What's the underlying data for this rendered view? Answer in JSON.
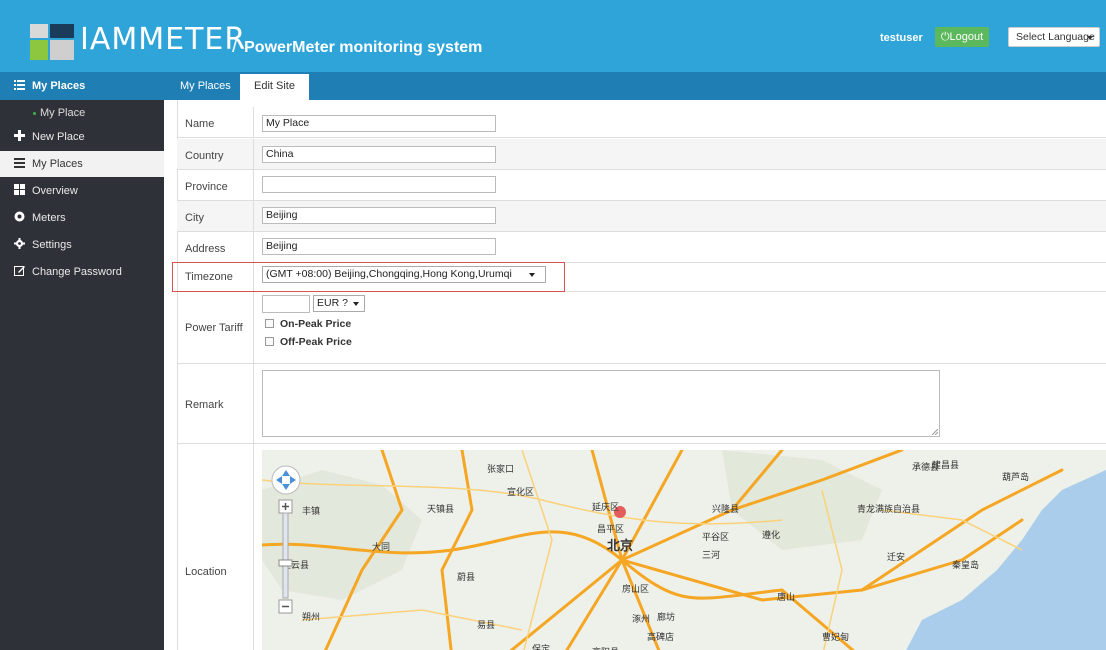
{
  "header": {
    "brand": "IAMMETER",
    "subtitle": "PowerMeter monitoring system",
    "username": "testuser",
    "logout_label": "Logout",
    "language_label": "Select Language",
    "bg_color": "#2fa4d8"
  },
  "sidebar": {
    "head": "My Places",
    "items": [
      {
        "label": "My Place",
        "icon": "dot-icon"
      },
      {
        "label": "New Place",
        "icon": "plus-icon"
      },
      {
        "label": "My Places",
        "icon": "list-icon"
      },
      {
        "label": "Overview",
        "icon": "grid-icon"
      },
      {
        "label": "Meters",
        "icon": "meter-icon"
      },
      {
        "label": "Settings",
        "icon": "gear-icon"
      },
      {
        "label": "Change Password",
        "icon": "edit-icon"
      }
    ]
  },
  "tabs": [
    {
      "label": "My Places"
    },
    {
      "label": "Edit Site"
    }
  ],
  "form": {
    "name_label": "Name",
    "name_value": "My Place",
    "country_label": "Country",
    "country_value": "China",
    "province_label": "Province",
    "province_value": "",
    "city_label": "City",
    "city_value": "Beijing",
    "address_label": "Address",
    "address_value": "Beijing",
    "timezone_label": "Timezone",
    "timezone_value": "(GMT +08:00) Beijing,Chongqing,Hong Kong,Urumqi",
    "tariff_label": "Power Tariff",
    "tariff_value": "",
    "currency_value": "EUR ?",
    "on_peak_label": "On-Peak Price",
    "off_peak_label": "Off-Peak Price",
    "remark_label": "Remark",
    "remark_value": "",
    "location_label": "Location"
  },
  "map": {
    "labels": [
      "张家口",
      "宣化区",
      "延庆区",
      "北京",
      "房山区",
      "涿州",
      "廊坊",
      "唐山",
      "天镇县",
      "大同",
      "兴隆县",
      "承德县",
      "秦皇岛",
      "迁安",
      "遵化",
      "平谷区",
      "三河",
      "易县",
      "高碑店",
      "保定",
      "朔州",
      "蔚县",
      "昌平区",
      "建昌县",
      "葫芦岛",
      "青龙满族自治县",
      "丰镇",
      "左云县",
      "曹妃甸",
      "高阳县"
    ]
  }
}
